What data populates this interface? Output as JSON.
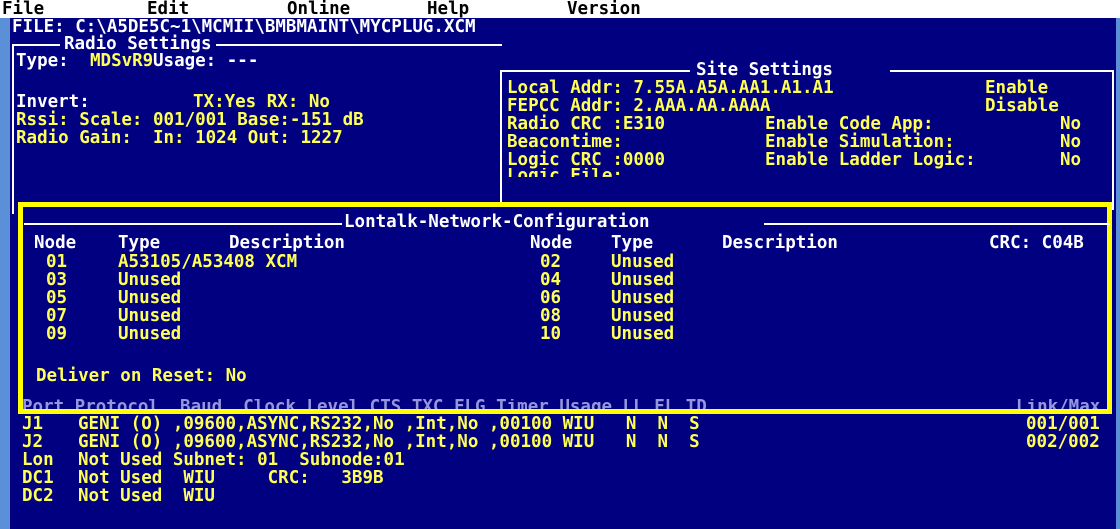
{
  "menu": [
    "File",
    "Edit",
    "Online",
    "Help",
    "Version"
  ],
  "file_line": "FILE: C:\\A5DE5C~1\\MCMII\\BMBMAINT\\MYCPLUG.XCM",
  "radio": {
    "title": "Radio Settings",
    "type_label": "Type:",
    "type_value": "MDSvR9",
    "usage": "Usage: ---",
    "invert_label": "Invert:",
    "invert_value": "TX:Yes RX: No",
    "rssi": "Rssi: Scale: 001/001 Base:-151 dB",
    "gain": "Radio Gain:  In: 1024 Out: 1227"
  },
  "site": {
    "title": "Site Settings",
    "local_addr": "Local Addr: 7.55A.A5A.AA1.A1.A1",
    "local_state": "Enable",
    "fepcc_addr": "FEPCC Addr: 2.AAA.AA.AAAA",
    "fepcc_state": "Disable",
    "radio_crc": "Radio CRC :E310",
    "code_app": "Enable Code App:",
    "code_app_value": "No",
    "beacontime": "Beacontime:",
    "simulation": "Enable Simulation:",
    "simulation_value": "No",
    "logic_crc": "Logic CRC :0000",
    "ladder": "Enable Ladder Logic:",
    "ladder_value": "No",
    "logic_file": "Logic File:"
  },
  "lontalk": {
    "title": "Lontalk-Network-Configuration",
    "hdr_node": "Node",
    "hdr_type": "Type",
    "hdr_desc": "Description",
    "crc": "CRC: C04B",
    "left": [
      {
        "node": "01",
        "type": "A53105/A53408 XCM"
      },
      {
        "node": "03",
        "type": "Unused"
      },
      {
        "node": "05",
        "type": "Unused"
      },
      {
        "node": "07",
        "type": "Unused"
      },
      {
        "node": "09",
        "type": "Unused"
      }
    ],
    "right": [
      {
        "node": "02",
        "type": "Unused"
      },
      {
        "node": "04",
        "type": "Unused"
      },
      {
        "node": "06",
        "type": "Unused"
      },
      {
        "node": "08",
        "type": "Unused"
      },
      {
        "node": "10",
        "type": "Unused"
      }
    ],
    "deliver": "Deliver on Reset: No"
  },
  "ports": {
    "header": "Port Protocol  Baud  Clock Level CTS TXC FLG Timer Usage LL FL TD",
    "header_link": "Link/Max",
    "rows": [
      {
        "port": "J1",
        "text": "GENI (O) ,09600,ASYNC,RS232,No ,Int,No ,00100 WIU   N  N  S",
        "link": "001/001"
      },
      {
        "port": "J2",
        "text": "GENI (O) ,09600,ASYNC,RS232,No ,Int,No ,00100 WIU   N  N  S",
        "link": "002/002"
      },
      {
        "port": "Lon",
        "text": "Not Used Subnet: 01  Subnode:01",
        "link": ""
      },
      {
        "port": "DC1",
        "text": "Not Used  WIU     CRC:   3B9B",
        "link": ""
      },
      {
        "port": "DC2",
        "text": "Not Used  WIU",
        "link": ""
      }
    ]
  },
  "colors": {
    "background": "#000080",
    "highlight": "#ffff54",
    "frame": "#ffff00",
    "text": "#ffffff"
  }
}
